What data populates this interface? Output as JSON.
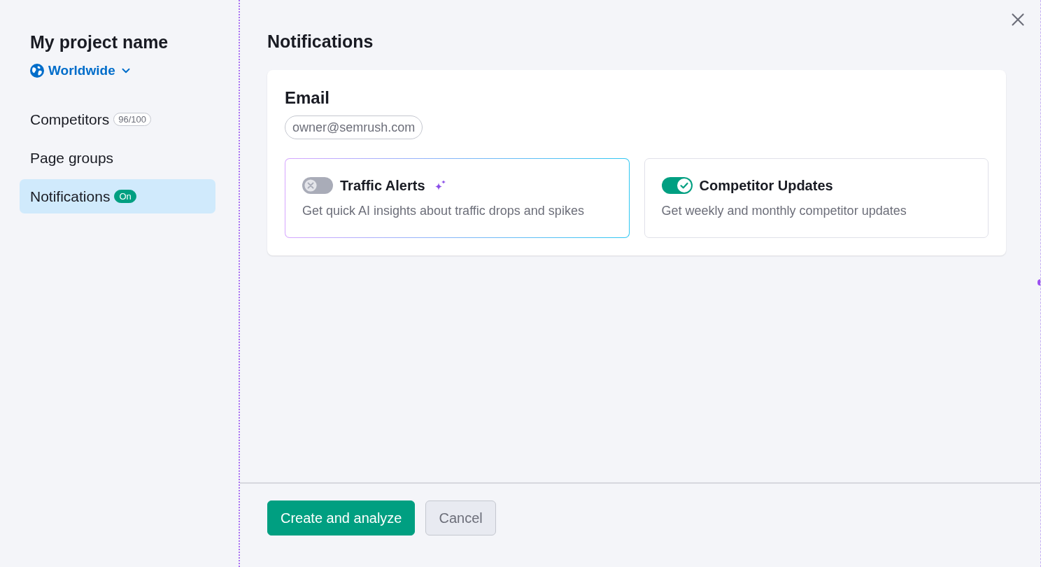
{
  "project": {
    "name": "My project name",
    "region": "Worldwide"
  },
  "sidebar": {
    "items": [
      {
        "label": "Competitors",
        "badge": {
          "text": "96/100",
          "kind": "count"
        },
        "selected": false
      },
      {
        "label": "Page groups",
        "selected": false
      },
      {
        "label": "Notifications",
        "badge": {
          "text": "On",
          "kind": "status"
        },
        "selected": true
      }
    ]
  },
  "page": {
    "title": "Notifications"
  },
  "email": {
    "title": "Email",
    "address": "owner@semrush.com",
    "options": [
      {
        "title": "Traffic Alerts",
        "description": "Get quick AI insights about traffic drops and spikes",
        "on": false,
        "ai": true
      },
      {
        "title": "Competitor Updates",
        "description": "Get weekly and monthly competitor updates",
        "on": true,
        "ai": false
      }
    ]
  },
  "footer": {
    "buttons": [
      {
        "label": "Create and analyze",
        "kind": "primary"
      },
      {
        "label": "Cancel",
        "kind": "secondary"
      }
    ]
  }
}
